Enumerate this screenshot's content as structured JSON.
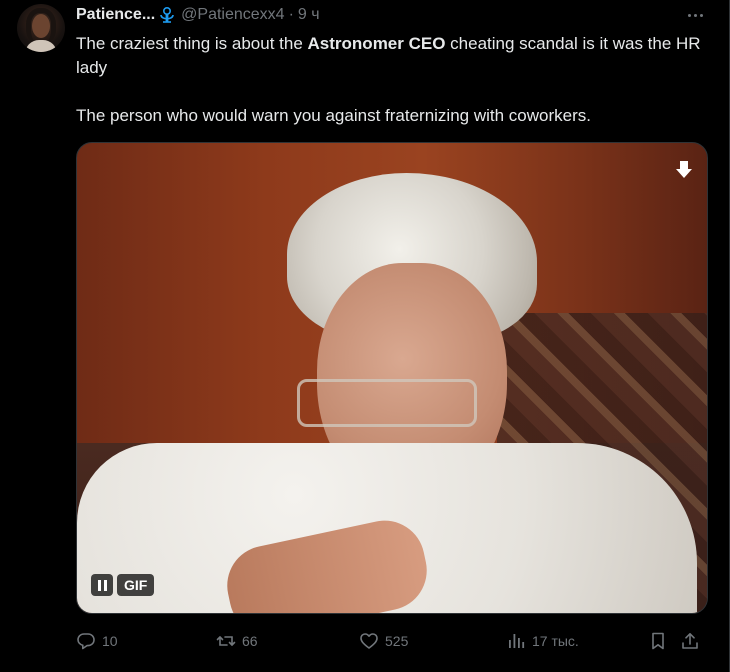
{
  "author": {
    "display_name": "Patience...",
    "handle": "@Patiencexx4",
    "separator": "·",
    "time": "9 ч"
  },
  "tweet": {
    "line1_pre": "The craziest thing is about the ",
    "line1_bold": "Astronomer CEO",
    "line1_post": " cheating scandal is it was the HR lady",
    "line2": "The person who would warn you against fraternizing with coworkers."
  },
  "media": {
    "gif_label": "GIF"
  },
  "actions": {
    "replies": "10",
    "retweets": "66",
    "likes": "525",
    "views": "17 тыс."
  },
  "colors": {
    "background": "#000000",
    "text": "#e7e9ea",
    "muted": "#71767b",
    "badge": "#1d9bf0"
  },
  "icons": {
    "badge": "verified-like-badge-icon",
    "more": "more-options-icon",
    "download": "download-arrow-icon",
    "pause": "pause-icon",
    "reply": "reply-bubble-icon",
    "retweet": "retweet-icon",
    "like": "heart-icon",
    "views": "views-bars-icon",
    "bookmark": "bookmark-icon",
    "share": "share-upload-icon"
  }
}
